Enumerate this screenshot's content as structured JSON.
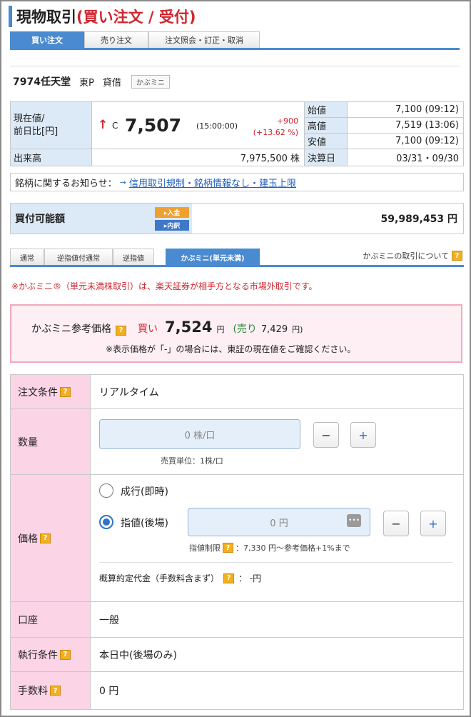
{
  "header": {
    "title_main": "現物取引",
    "title_sub": "(買い注文 / 受付)"
  },
  "tabs": [
    "買い注文",
    "売り注文",
    "注文照会・訂正・取消"
  ],
  "stock": {
    "code_name": "7974任天堂",
    "market": "東P",
    "margin": "貸借",
    "badge": "かぶミニ"
  },
  "quote": {
    "price_label": "現在値/\n前日比[円]",
    "arrow": "↑",
    "c_mark": "C",
    "price": "7,507",
    "time": "(15:00:00)",
    "change": "+900",
    "change_pct": "(+13.62 %)",
    "open_label": "始値",
    "open": "7,100 (09:12)",
    "high_label": "高値",
    "high": "7,519 (13:06)",
    "low_label": "安値",
    "low": "7,100 (09:12)",
    "volume_label": "出来高",
    "volume": "7,975,500 株",
    "settle_label": "決算日",
    "settle": "03/31・09/30"
  },
  "notice": {
    "label": "銘柄に関するお知らせ：",
    "arrow": "→",
    "link": "信用取引規制・銘柄情報なし・建玉上限"
  },
  "buying_power": {
    "label": "買付可能額",
    "deposit_btn": "▸入金",
    "detail_btn": "▸内訳",
    "value": "59,989,453 円"
  },
  "order_tabs": [
    "通常",
    "逆指値付通常",
    "逆指値",
    "かぶミニ(単元未満)"
  ],
  "about_link": "かぶミニの取引について",
  "warning": "※かぶミニ®（単元未満株取引）は、楽天証券が相手方となる市場外取引です。",
  "ref_price": {
    "label": "かぶミニ参考価格",
    "buy_label": "買い",
    "buy_value": "7,524",
    "yen": "円",
    "sell_open": "(売り",
    "sell_value": "7,429",
    "sell_yen": "円)",
    "note": "※表示価格が「-」の場合には、東証の現在値をご確認ください。"
  },
  "order": {
    "cond_label": "注文条件",
    "cond_value": "リアルタイム",
    "qty_label": "数量",
    "qty_placeholder": "0 株/口",
    "qty_unit": "売買単位：1株/口",
    "price_label": "価格",
    "market_order": "成行(即時)",
    "limit_order": "指値(後場)",
    "price_placeholder": "0 円",
    "limit_note_label": "指値制限",
    "limit_note": "：7,330 円〜参考価格+1%まで",
    "estimate_label": "概算約定代金（手数料含まず）",
    "estimate_value": "：  -円",
    "account_label": "口座",
    "account_value": "一般",
    "exec_label": "執行条件",
    "exec_value": "本日中(後場のみ)",
    "fee_label": "手数料",
    "fee_value": "0 円"
  },
  "colors": {
    "accent": "#4a8ad0",
    "red": "#d0262e",
    "pink_label": "#fbd4e6",
    "blue_label": "#dce9f6"
  }
}
